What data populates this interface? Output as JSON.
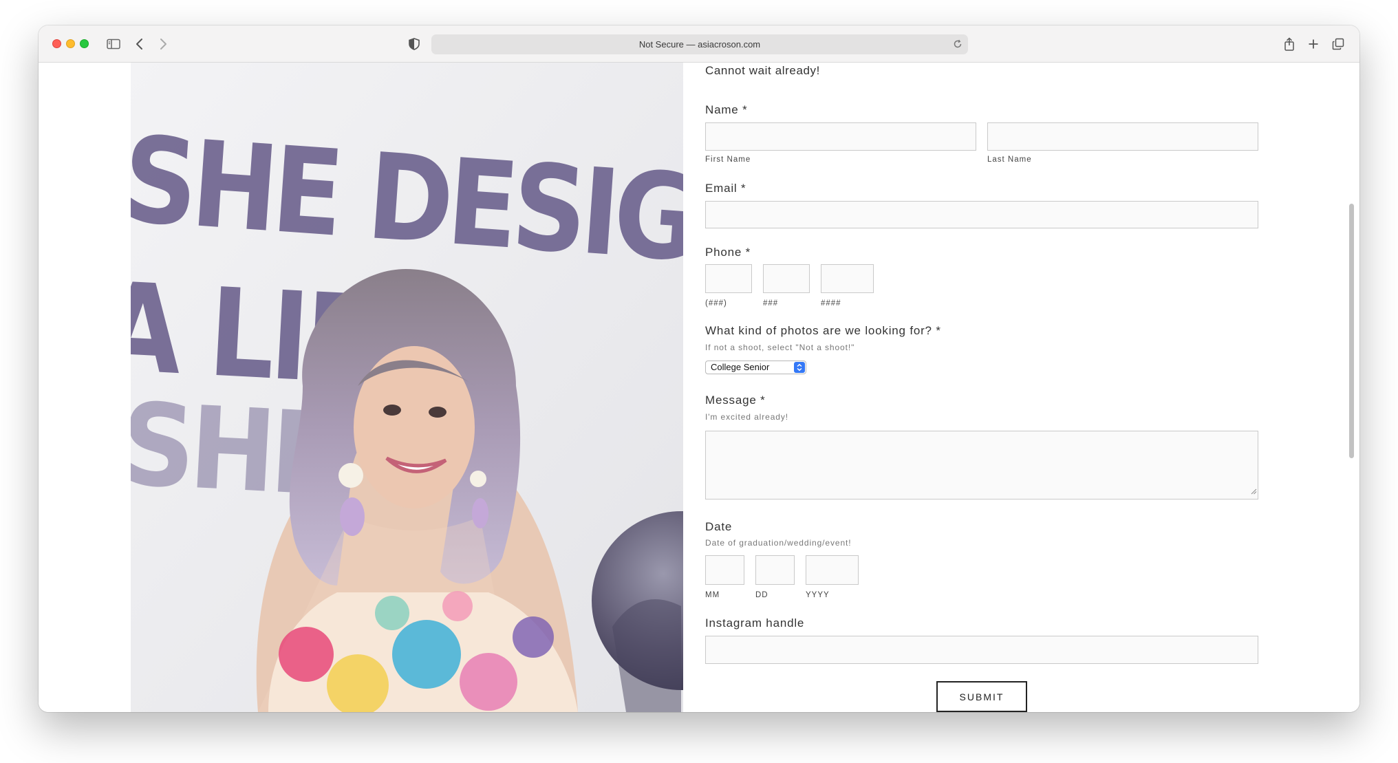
{
  "browser": {
    "address": "Not Secure — asiacroson.com",
    "icons": [
      "sidebar-icon",
      "back-icon",
      "forward-icon",
      "shield-icon",
      "reload-icon",
      "share-icon",
      "plus-icon",
      "tabs-icon"
    ]
  },
  "photo": {
    "wall_text": [
      "SHE DESIGNED",
      "A LIFE",
      "SHE"
    ]
  },
  "form": {
    "intro": "Cannot wait already!",
    "name": {
      "label": "Name *",
      "first_sublabel": "First Name",
      "last_sublabel": "Last Name",
      "first_value": "",
      "last_value": ""
    },
    "email": {
      "label": "Email *",
      "value": ""
    },
    "phone": {
      "label": "Phone *",
      "sublabels": [
        "(###)",
        "###",
        "####"
      ]
    },
    "photos": {
      "label": "What kind of photos are we looking for? *",
      "hint": "If not a shoot, select \"Not a shoot!\"",
      "selected": "College Senior"
    },
    "message": {
      "label": "Message *",
      "hint": "I'm excited already!",
      "value": ""
    },
    "date": {
      "label": "Date",
      "hint": "Date of graduation/wedding/event!",
      "sublabels": [
        "MM",
        "DD",
        "YYYY"
      ]
    },
    "instagram": {
      "label": "Instagram handle",
      "value": ""
    },
    "submit_label": "SUBMIT"
  },
  "colors": {
    "accent": "#3478f6",
    "wall_letters": "#6f6590",
    "text": "#333333"
  }
}
